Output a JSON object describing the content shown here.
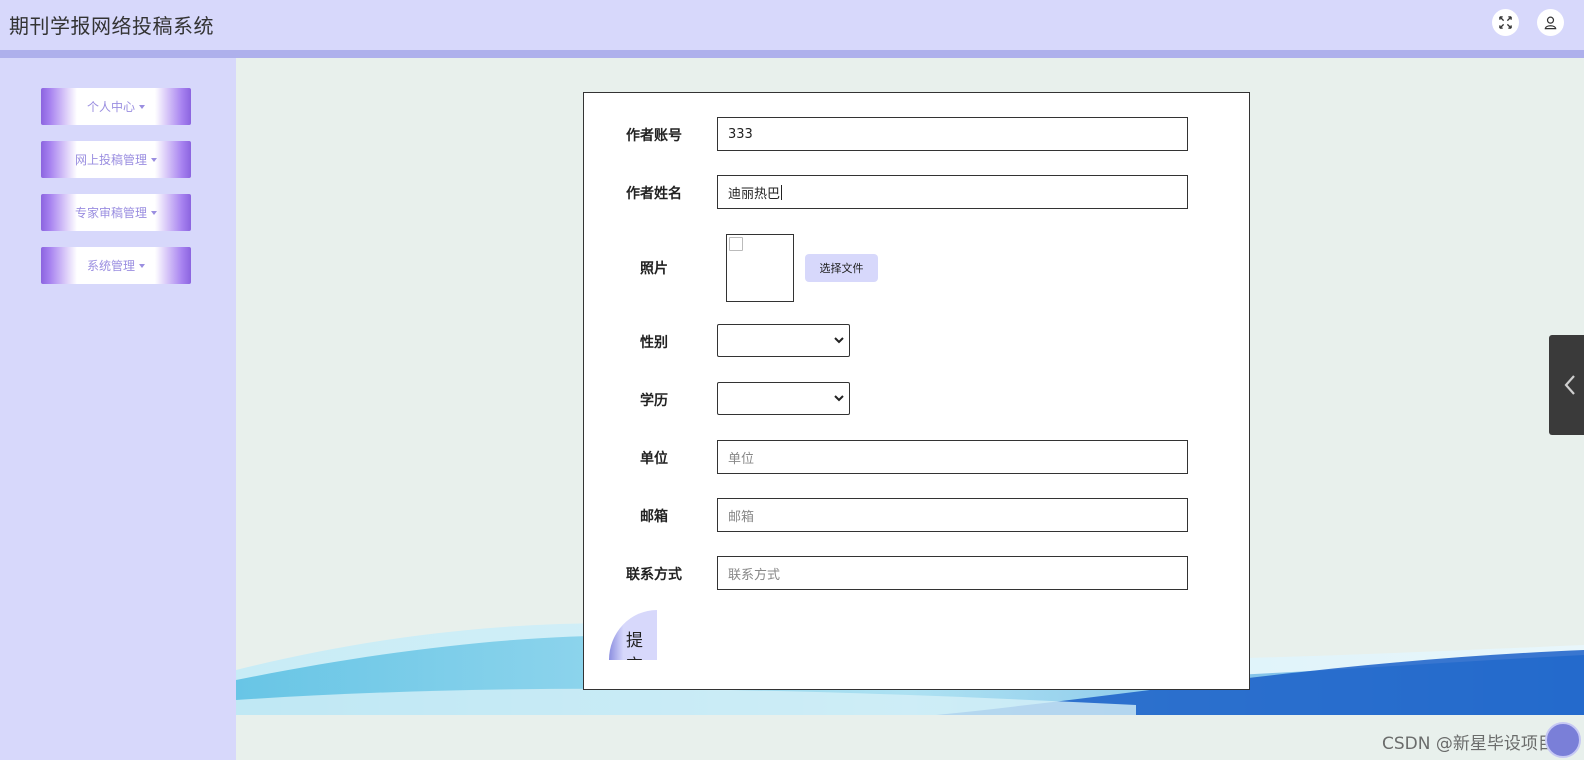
{
  "header": {
    "title": "期刊学报网络投稿系统",
    "icons": [
      "fullscreen-icon",
      "user-icon"
    ]
  },
  "sidebar": {
    "items": [
      {
        "label": "个人中心"
      },
      {
        "label": "网上投稿管理"
      },
      {
        "label": "专家审稿管理"
      },
      {
        "label": "系统管理"
      }
    ]
  },
  "form": {
    "author_account": {
      "label": "作者账号",
      "value": "333"
    },
    "author_name": {
      "label": "作者姓名",
      "value": "迪丽热巴"
    },
    "photo": {
      "label": "照片",
      "button": "选择文件"
    },
    "gender": {
      "label": "性别",
      "value": ""
    },
    "education": {
      "label": "学历",
      "value": ""
    },
    "unit": {
      "label": "单位",
      "placeholder": "单位"
    },
    "email": {
      "label": "邮箱",
      "placeholder": "邮箱"
    },
    "contact": {
      "label": "联系方式",
      "placeholder": "联系方式"
    },
    "submit": "提交"
  },
  "watermark": "CSDN @新星毕设项目",
  "colors": {
    "header_bg": "#d7d8fb",
    "accent": "#8b64df",
    "main_bg": "#e8f0ec"
  }
}
